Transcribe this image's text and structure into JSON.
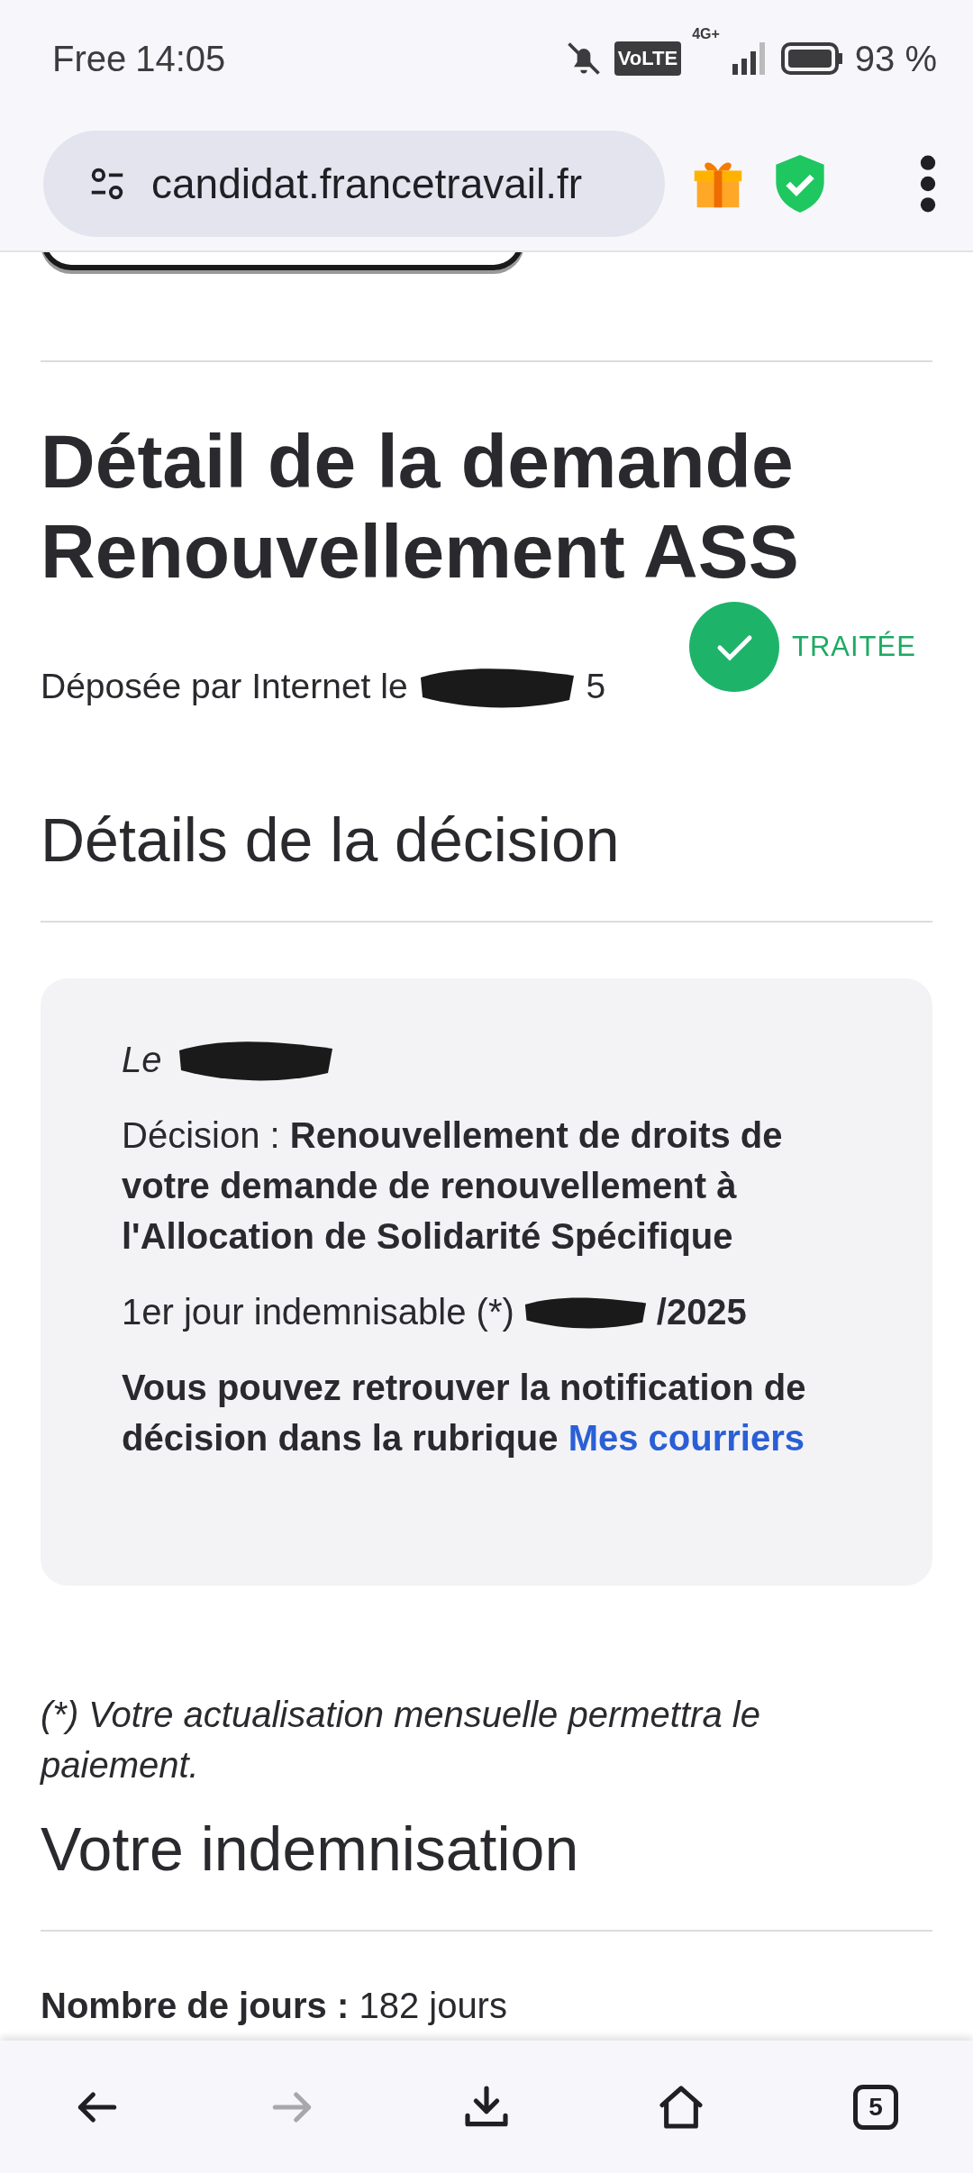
{
  "status_bar": {
    "carrier": "Free",
    "time": "14:05",
    "network_badge": "VoLTE",
    "network_type": "4G+",
    "battery": "93 %"
  },
  "address_bar": {
    "url": "candidat.francetravail.fr"
  },
  "request": {
    "title_lines": [
      "Détail de la demande",
      "Renouvellement ASS"
    ],
    "status_label": "TRAITÉE",
    "submitted_prefix": "Déposée par Internet le",
    "submitted_suffix": "5"
  },
  "decision": {
    "heading": "Détails de la décision",
    "date_prefix": "Le",
    "decision_label": "Décision : ",
    "decision_text": "Renouvellement de droits de votre demande de renouvellement à l'Allocation de Solidarité Spécifique",
    "first_day_label": "1er jour indemnisable (*)",
    "first_day_suffix": "/2025",
    "notice": "Vous pouvez retrouver la notification de décision dans la rubrique",
    "notice_link": "Mes courriers"
  },
  "footnote": "(*) Votre actualisation mensuelle permettra le paiement.",
  "compensation": {
    "heading": "Votre indemnisation",
    "days_label": "Nombre de jours :",
    "days_value": "182 jours"
  },
  "bottom_nav": [
    {
      "kind": "back",
      "disabled": false
    },
    {
      "kind": "forward",
      "disabled": true
    },
    {
      "kind": "download",
      "disabled": false
    },
    {
      "kind": "home",
      "disabled": false
    },
    {
      "kind": "tabs",
      "label": "5",
      "disabled": false
    }
  ]
}
